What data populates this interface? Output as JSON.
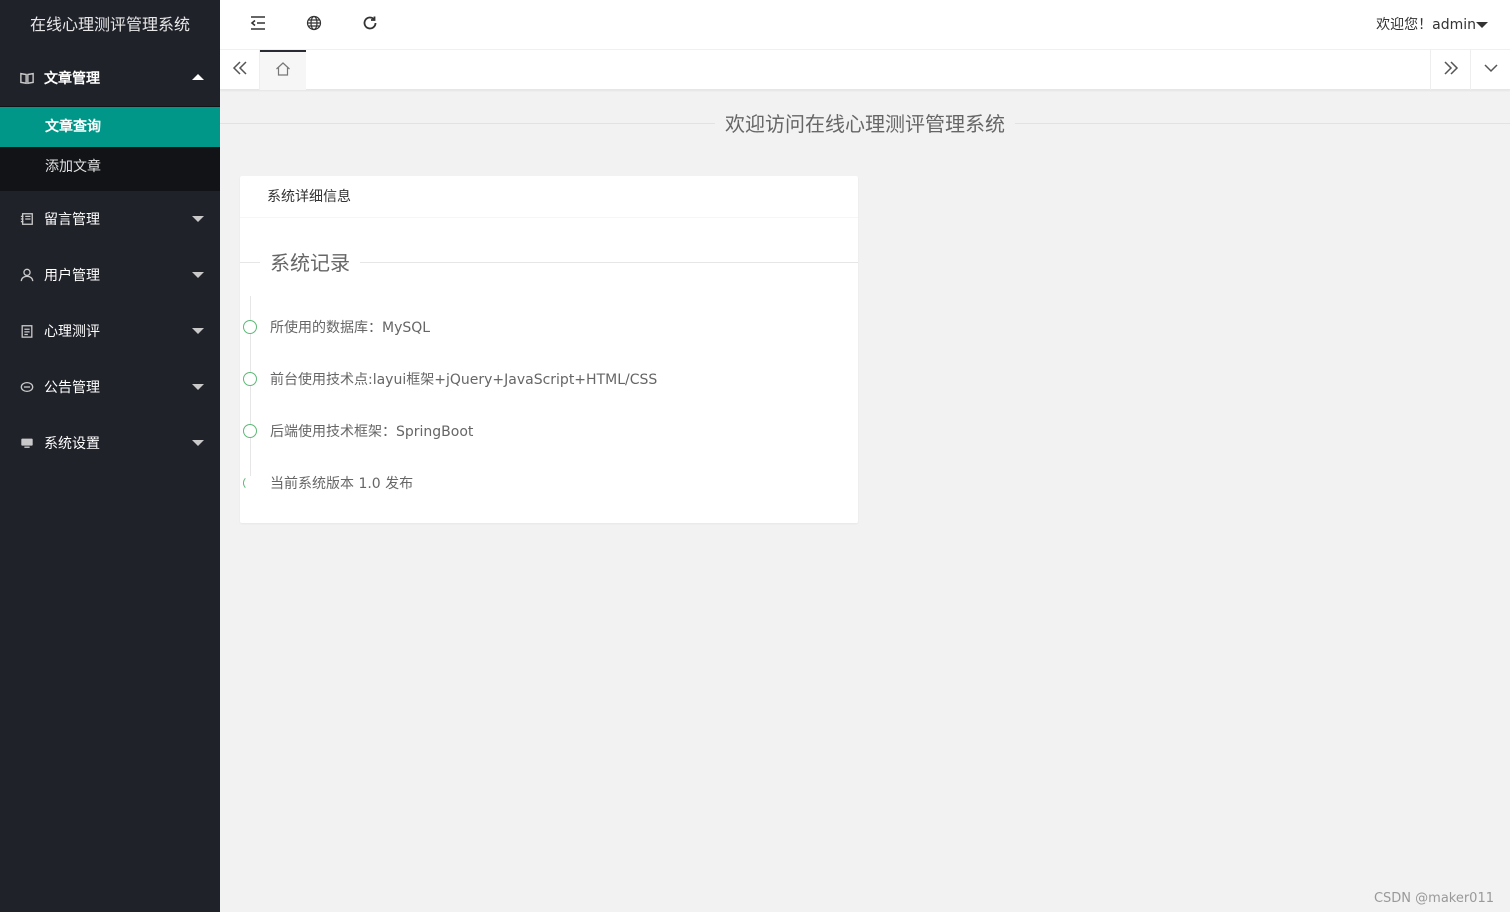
{
  "sidebar": {
    "logo": "在线心理测评管理系统",
    "menus": [
      {
        "label": "文章管理",
        "icon": "book-icon",
        "open": true,
        "children": [
          {
            "label": "文章查询",
            "active": true
          },
          {
            "label": "添加文章",
            "active": false
          }
        ]
      },
      {
        "label": "留言管理",
        "icon": "notebook-icon"
      },
      {
        "label": "用户管理",
        "icon": "user-icon"
      },
      {
        "label": "心理测评",
        "icon": "clipboard-icon"
      },
      {
        "label": "公告管理",
        "icon": "chat-icon"
      },
      {
        "label": "系统设置",
        "icon": "monitor-icon"
      }
    ]
  },
  "header": {
    "user_text": "欢迎您！admin",
    "icons": [
      "menu-toggle-icon",
      "globe-icon",
      "refresh-icon"
    ]
  },
  "tabs": {
    "home_icon": "home-icon"
  },
  "main": {
    "welcome": "欢迎访问在线心理测评管理系统",
    "card_title": "系统详细信息",
    "legend": "系统记录",
    "timeline": [
      "所使用的数据库：MySQL",
      "前台使用技术点:layui框架+jQuery+JavaScript+HTML/CSS",
      "后端使用技术框架：SpringBoot",
      "当前系统版本 1.0 发布"
    ]
  },
  "watermark": "CSDN @maker011",
  "colors": {
    "sidebar_bg": "#20222a",
    "active": "#009688",
    "timeline_dot": "#5FB878"
  }
}
